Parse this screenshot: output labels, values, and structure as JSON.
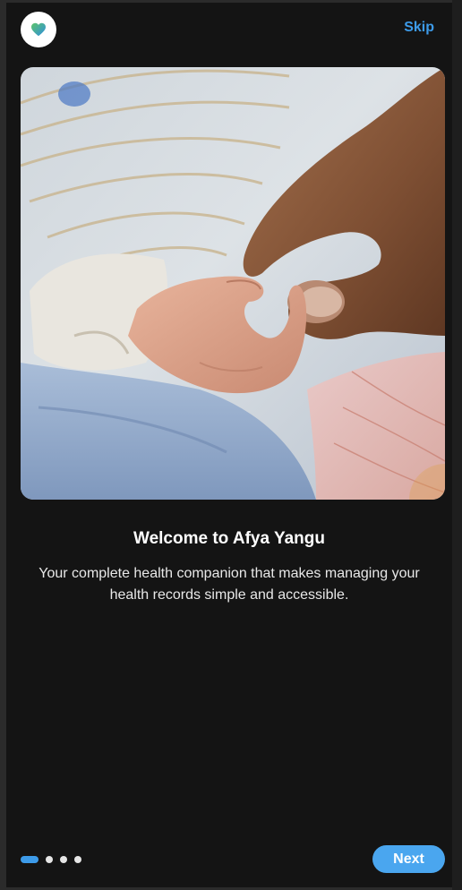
{
  "header": {
    "logo_icon": "heart-icon",
    "skip_label": "Skip"
  },
  "hero": {
    "image_subject": "adult-hand-holding-baby-hand-photo"
  },
  "content": {
    "title": "Welcome to Afya Yangu",
    "description": "Your complete health companion that makes managing your health records simple and accessible."
  },
  "pagination": {
    "total": 4,
    "current": 1
  },
  "footer": {
    "next_label": "Next"
  },
  "colors": {
    "accent": "#3d9be9",
    "background": "#141414",
    "heart_green": "#5cc46a",
    "heart_blue": "#2f8fe0"
  }
}
